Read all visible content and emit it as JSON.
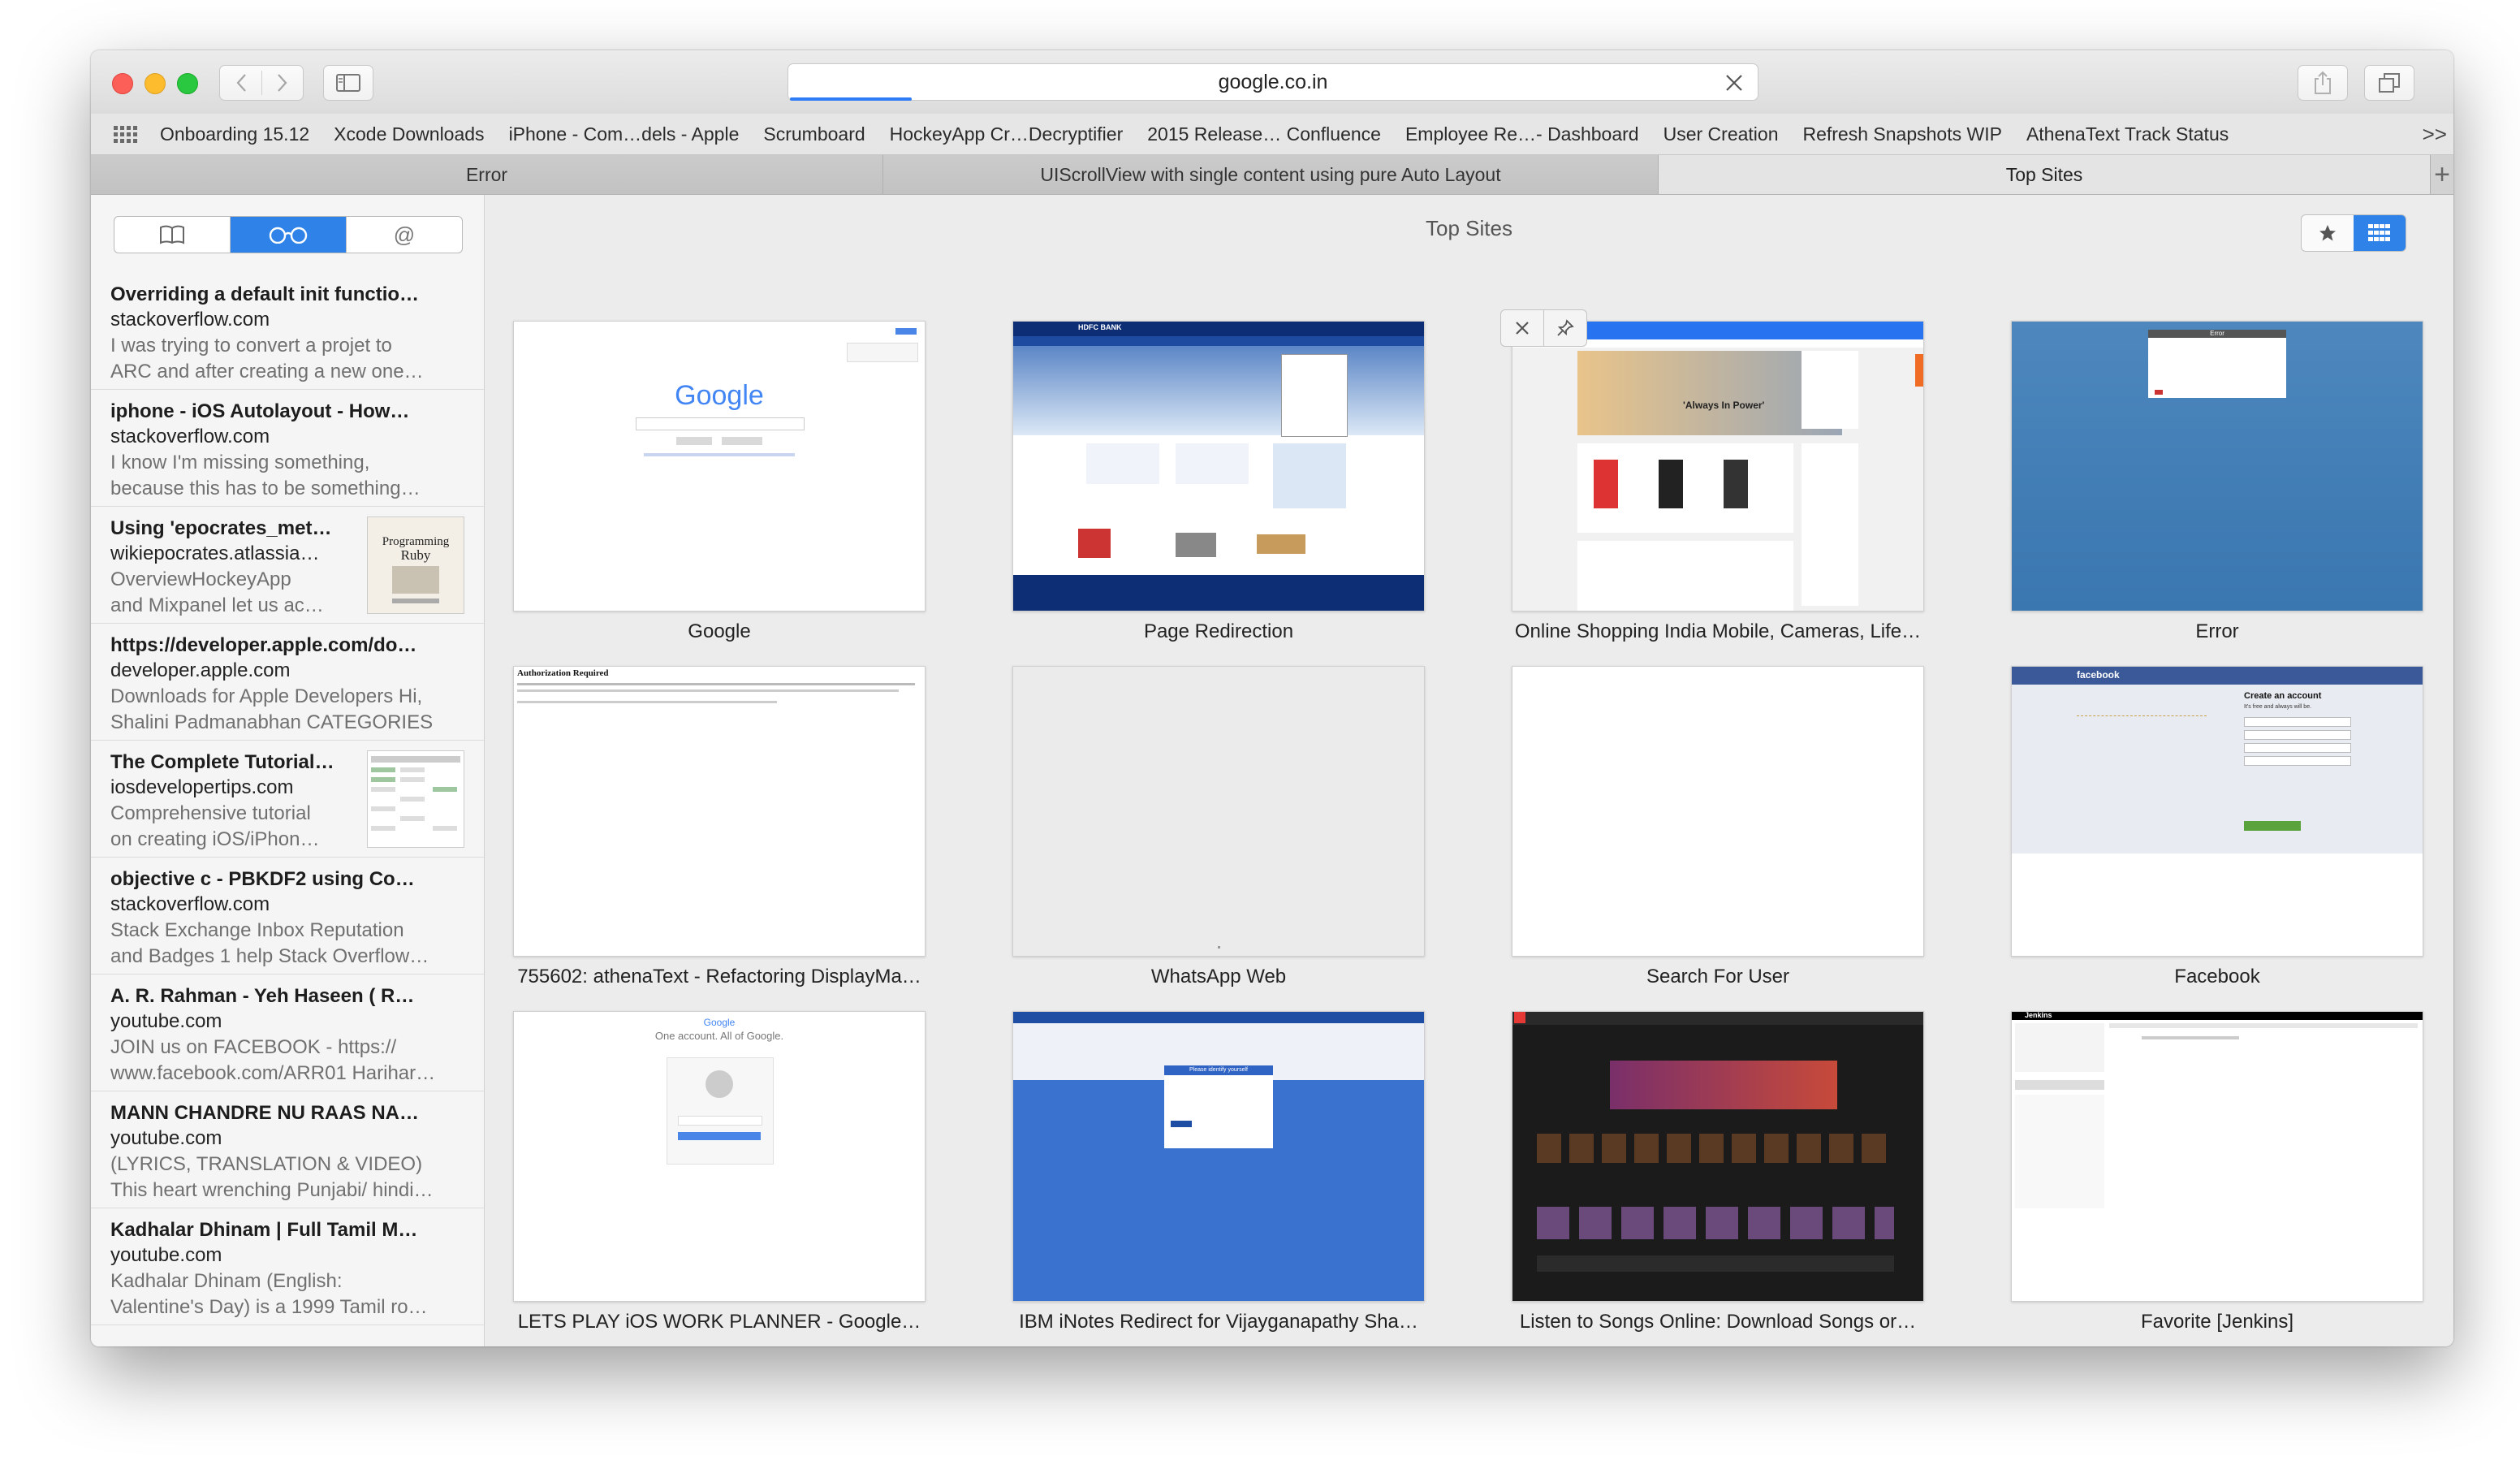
{
  "toolbar": {
    "address": "google.co.in"
  },
  "bookmarks": [
    "Onboarding 15.12",
    "Xcode Downloads",
    "iPhone - Com…dels - Apple",
    "Scrumboard",
    "HockeyApp Cr…Decryptifier",
    "2015 Release… Confluence",
    "Employee Re…- Dashboard",
    "User Creation",
    "Refresh Snapshots WIP",
    "AthenaText Track Status"
  ],
  "bookmarks_more": ">>",
  "tabs": [
    {
      "label": "Error",
      "active": false
    },
    {
      "label": "UIScrollView with single content using pure Auto Layout",
      "active": false
    },
    {
      "label": "Top Sites",
      "active": true
    }
  ],
  "tab_add": "+",
  "sidebar": {
    "segments": [
      "bookmarks-icon",
      "reading-list-icon",
      "shared-links-icon"
    ],
    "segment_symbol": "@",
    "reading_list": [
      {
        "title": "Overriding a default init functio…",
        "domain": "stackoverflow.com",
        "desc": [
          "I was trying to convert a projet to",
          "ARC and after creating a new one…"
        ]
      },
      {
        "title": "iphone - iOS Autolayout - How…",
        "domain": "stackoverflow.com",
        "desc": [
          "I know I'm missing something,",
          "because this has to be something…"
        ]
      },
      {
        "title": "Using 'epocrates_met…",
        "domain": "wikiepocrates.atlassia…",
        "desc": [
          "OverviewHockeyApp",
          "and Mixpanel let us ac…"
        ],
        "thumb": "book"
      },
      {
        "title": "https://developer.apple.com/do…",
        "domain": "developer.apple.com",
        "desc": [
          "Downloads for Apple Developers Hi,",
          "Shalini Padmanabhan CATEGORIES"
        ]
      },
      {
        "title": "The Complete Tutorial…",
        "domain": "iosdevelopertips.com",
        "desc": [
          "Comprehensive tutorial",
          "on creating iOS/iPhon…"
        ],
        "thumb": "table"
      },
      {
        "title": "objective c - PBKDF2 using Co…",
        "domain": "stackoverflow.com",
        "desc": [
          "Stack Exchange Inbox Reputation",
          "and Badges 1 help Stack Overflow…"
        ]
      },
      {
        "title": "A. R. Rahman - Yeh Haseen ( R…",
        "domain": "youtube.com",
        "desc": [
          "JOIN us on FACEBOOK - https://",
          "www.facebook.com/ARR01 Harihar…"
        ]
      },
      {
        "title": "MANN CHANDRE NU RAAS NA…",
        "domain": "youtube.com",
        "desc": [
          "(LYRICS, TRANSLATION & VIDEO)",
          "This heart wrenching Punjabi/ hindi…"
        ]
      },
      {
        "title": "Kadhalar Dhinam | Full Tamil M…",
        "domain": "youtube.com",
        "desc": [
          "Kadhalar Dhinam (English:",
          "Valentine's Day) is a 1999 Tamil ro…"
        ]
      }
    ]
  },
  "top_sites": {
    "title": "Top Sites",
    "sites": [
      {
        "label": "Google",
        "thumb": "google"
      },
      {
        "label": "Page Redirection",
        "thumb": "bank"
      },
      {
        "label": "Online Shopping India Mobile, Cameras, Life…",
        "thumb": "shop"
      },
      {
        "label": "Error",
        "thumb": "error"
      },
      {
        "label": "755602: athenaText - Refactoring DisplayMa…",
        "thumb": "auth"
      },
      {
        "label": "WhatsApp Web",
        "thumb": "blank-gray"
      },
      {
        "label": "Search For User",
        "thumb": "blank-white"
      },
      {
        "label": "Facebook",
        "thumb": "facebook"
      },
      {
        "label": "LETS PLAY iOS WORK PLANNER - Google…",
        "thumb": "google-signin"
      },
      {
        "label": "IBM iNotes Redirect for Vijayganapathy Sha…",
        "thumb": "tcs"
      },
      {
        "label": "Listen to Songs Online: Download Songs or…",
        "thumb": "music"
      },
      {
        "label": "Favorite [Jenkins]",
        "thumb": "jenkins"
      }
    ]
  },
  "thumb_text": {
    "google_logo": "Google",
    "google_signin_logo": "Google",
    "google_signin_heading": "One account. All of Google.",
    "auth_title": "Authorization Required",
    "facebook_brand": "facebook",
    "facebook_create": "Create an account",
    "facebook_free": "It's free and always will be.",
    "error_heading": "Error",
    "tcs_prompt": "Please identify yourself",
    "jenkins_brand": "Jenkins",
    "shop_banner": "'Always In Power'",
    "bank_brand": "HDFC BANK"
  },
  "colors": {
    "accent": "#2f83e8",
    "close": "#fc5f57",
    "minimize": "#fdbc2e",
    "maximize": "#29c840",
    "progress": "#2f7cf6"
  }
}
